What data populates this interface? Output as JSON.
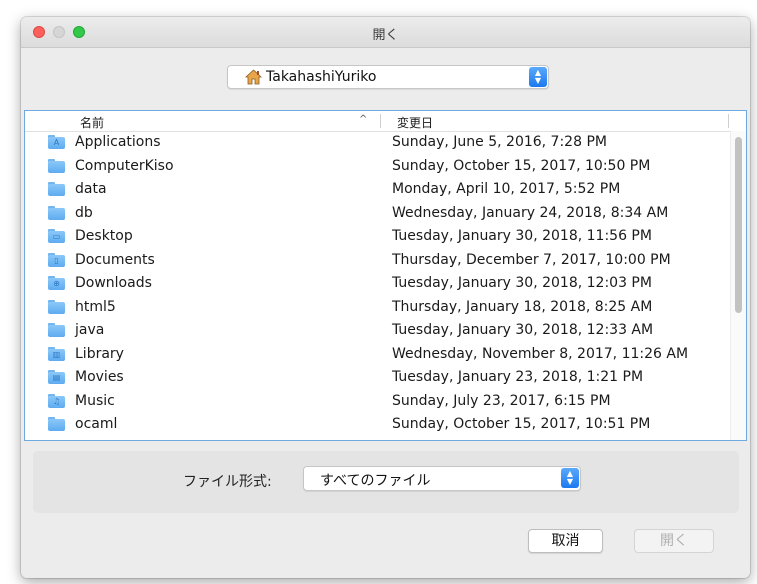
{
  "window": {
    "title": "開く"
  },
  "location": {
    "selected": "TakahashiYuriko",
    "icon": "home-icon"
  },
  "columns": {
    "name": "名前",
    "date": "変更日",
    "sort_indicator": "^"
  },
  "files": [
    {
      "name": "Applications",
      "modified": "Sunday, June 5, 2016, 7:28 PM",
      "icon": "applications-folder-icon"
    },
    {
      "name": "ComputerKiso",
      "modified": "Sunday, October 15, 2017, 10:50 PM",
      "icon": "folder-icon"
    },
    {
      "name": "data",
      "modified": "Monday, April 10, 2017, 5:52 PM",
      "icon": "folder-icon"
    },
    {
      "name": "db",
      "modified": "Wednesday, January 24, 2018, 8:34 AM",
      "icon": "folder-icon"
    },
    {
      "name": "Desktop",
      "modified": "Tuesday, January 30, 2018, 11:56 PM",
      "icon": "desktop-folder-icon"
    },
    {
      "name": "Documents",
      "modified": "Thursday, December 7, 2017, 10:00 PM",
      "icon": "documents-folder-icon"
    },
    {
      "name": "Downloads",
      "modified": "Tuesday, January 30, 2018, 12:03 PM",
      "icon": "downloads-folder-icon"
    },
    {
      "name": "html5",
      "modified": "Thursday, January 18, 2018, 8:25 AM",
      "icon": "folder-icon"
    },
    {
      "name": "java",
      "modified": "Tuesday, January 30, 2018, 12:33 AM",
      "icon": "folder-icon"
    },
    {
      "name": "Library",
      "modified": "Wednesday, November 8, 2017, 11:26 AM",
      "icon": "library-folder-icon"
    },
    {
      "name": "Movies",
      "modified": "Tuesday, January 23, 2018, 1:21 PM",
      "icon": "movies-folder-icon"
    },
    {
      "name": "Music",
      "modified": "Sunday, July 23, 2017, 6:15 PM",
      "icon": "music-folder-icon"
    },
    {
      "name": "ocaml",
      "modified": "Sunday, October 15, 2017, 10:51 PM",
      "icon": "folder-icon"
    }
  ],
  "filter": {
    "label": "ファイル形式:",
    "value": "すべてのファイル"
  },
  "buttons": {
    "cancel": "取消",
    "open": "開く"
  },
  "colors": {
    "accent": "#1b78f0",
    "selection_border": "#6ea9df",
    "folder": "#5dabf0"
  }
}
